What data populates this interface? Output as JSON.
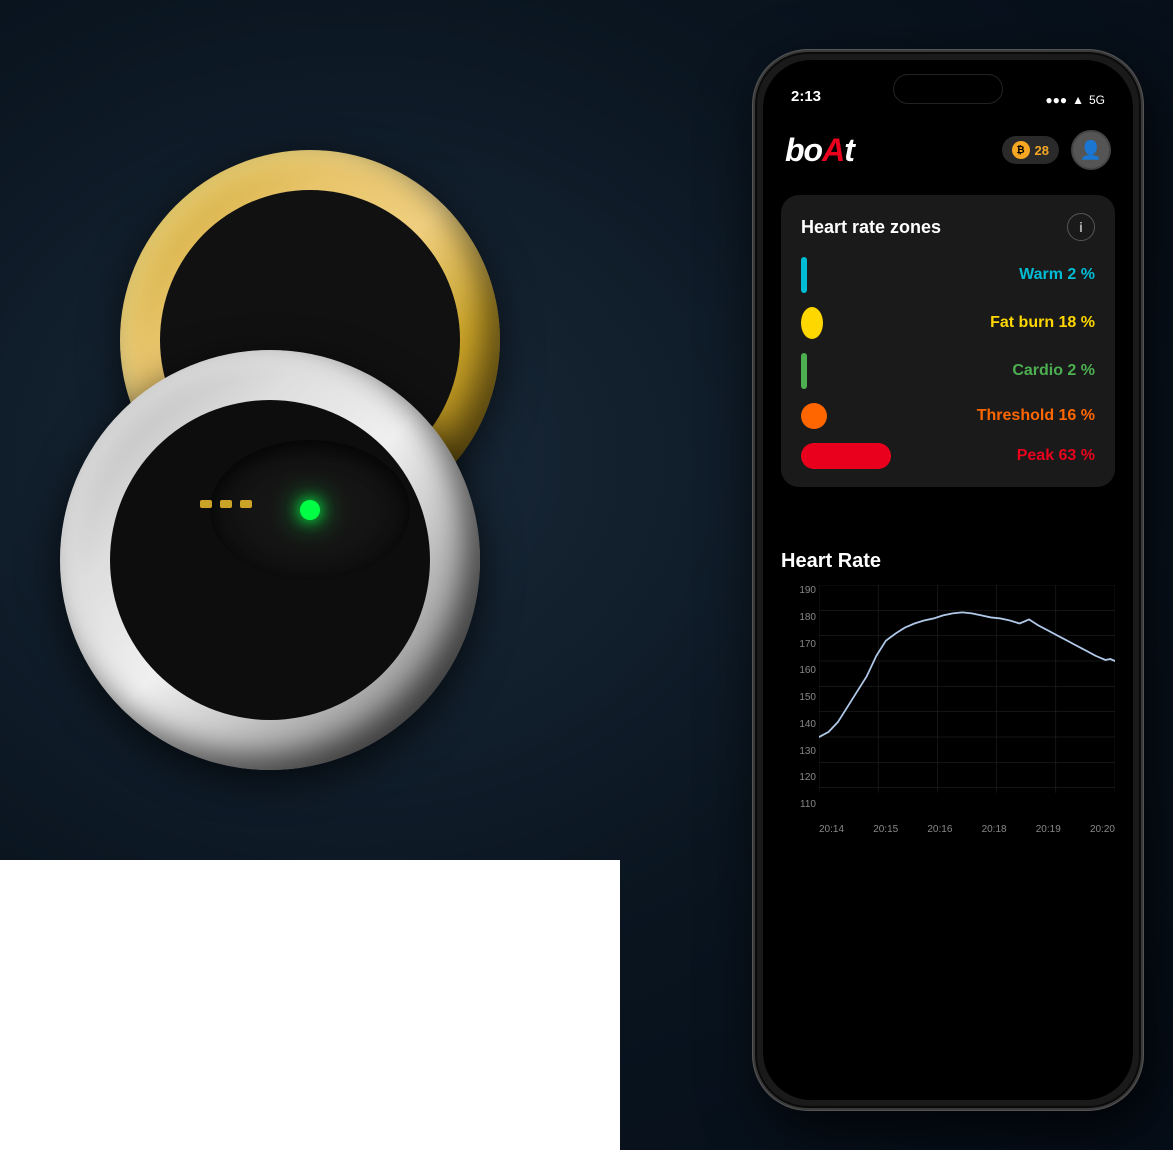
{
  "background": {
    "color": "#0a1520"
  },
  "status_bar": {
    "time": "2:13",
    "signal": "●●●",
    "wifi": "wifi",
    "battery": "5G"
  },
  "app_header": {
    "logo": "boat",
    "logo_red_char": "A",
    "coins": "28",
    "avatar_icon": "👤"
  },
  "hr_zones_card": {
    "title": "Heart rate zones",
    "info_icon": "i",
    "zones": [
      {
        "name": "Warm",
        "percentage": "2 %",
        "color": "#00bcd4",
        "indicator_type": "thin_bar"
      },
      {
        "name": "Fat burn",
        "percentage": "18 %",
        "color": "#ffd700",
        "indicator_type": "oval"
      },
      {
        "name": "Cardio",
        "percentage": "2 %",
        "color": "#4caf50",
        "indicator_type": "thin_bar"
      },
      {
        "name": "Threshold",
        "percentage": "16 %",
        "color": "#ff6600",
        "indicator_type": "circle"
      },
      {
        "name": "Peak",
        "percentage": "63 %",
        "color": "#e8001d",
        "indicator_type": "wide_bar"
      }
    ]
  },
  "hr_chart": {
    "title": "Heart Rate",
    "y_labels": [
      "190",
      "180",
      "170",
      "160",
      "150",
      "140",
      "130",
      "120",
      "110"
    ],
    "x_labels": [
      "20:14",
      "20:15",
      "20:16",
      "20:18",
      "20:19",
      "20:20"
    ],
    "line_color": "#b0c8e8",
    "grid_color": "#2a2a2a"
  },
  "ring_image": {
    "description": "Boat smart ring - gold and silver dual ring with green sensor"
  }
}
